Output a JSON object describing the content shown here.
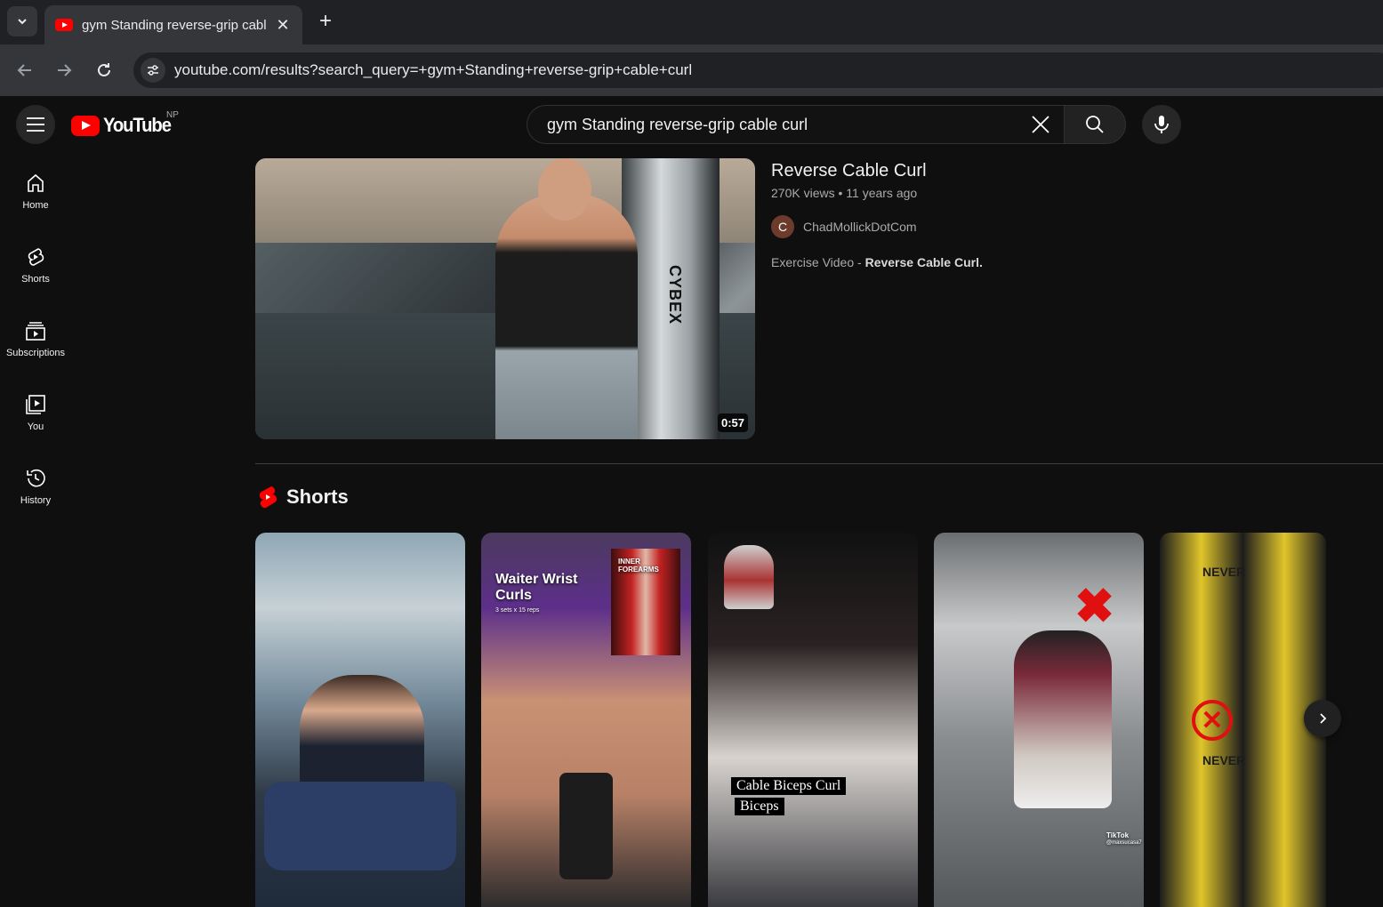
{
  "browser": {
    "tab_title": "gym Standing reverse-grip cabl",
    "url": "youtube.com/results?search_query=+gym+Standing+reverse-grip+cable+curl"
  },
  "header": {
    "logo_text": "YouTube",
    "country_code": "NP",
    "search_query": "gym Standing reverse-grip cable curl"
  },
  "guide": {
    "items": [
      {
        "label": "Home",
        "icon": "home-icon"
      },
      {
        "label": "Shorts",
        "icon": "shorts-icon"
      },
      {
        "label": "Subscriptions",
        "icon": "subscriptions-icon"
      },
      {
        "label": "You",
        "icon": "you-icon"
      },
      {
        "label": "History",
        "icon": "history-icon"
      }
    ]
  },
  "result": {
    "title": "Reverse Cable Curl",
    "meta": "270K views • 11 years ago",
    "channel_initial": "C",
    "channel_name": "ChadMollickDotCom",
    "description_prefix": "Exercise Video - ",
    "description_bold": "Reverse Cable Curl.",
    "duration": "0:57",
    "thumbnail_brand": "CYBEX"
  },
  "shorts": {
    "heading": "Shorts",
    "items": [
      {
        "overlay": ""
      },
      {
        "overlay": "Waiter Wrist Curls",
        "overlay2": "INNER FOREARMS",
        "overlay3": "3 sets x 15 reps"
      },
      {
        "caption1": "Cable Biceps Curl",
        "caption2": "Biceps"
      },
      {
        "watermark": "TikTok",
        "handle": "@maxsucasa7"
      },
      {
        "overlay": "NEVER",
        "overlay_b": "NEVER"
      }
    ]
  },
  "colors": {
    "accent": "#ff0000",
    "background": "#0f0f0f"
  }
}
